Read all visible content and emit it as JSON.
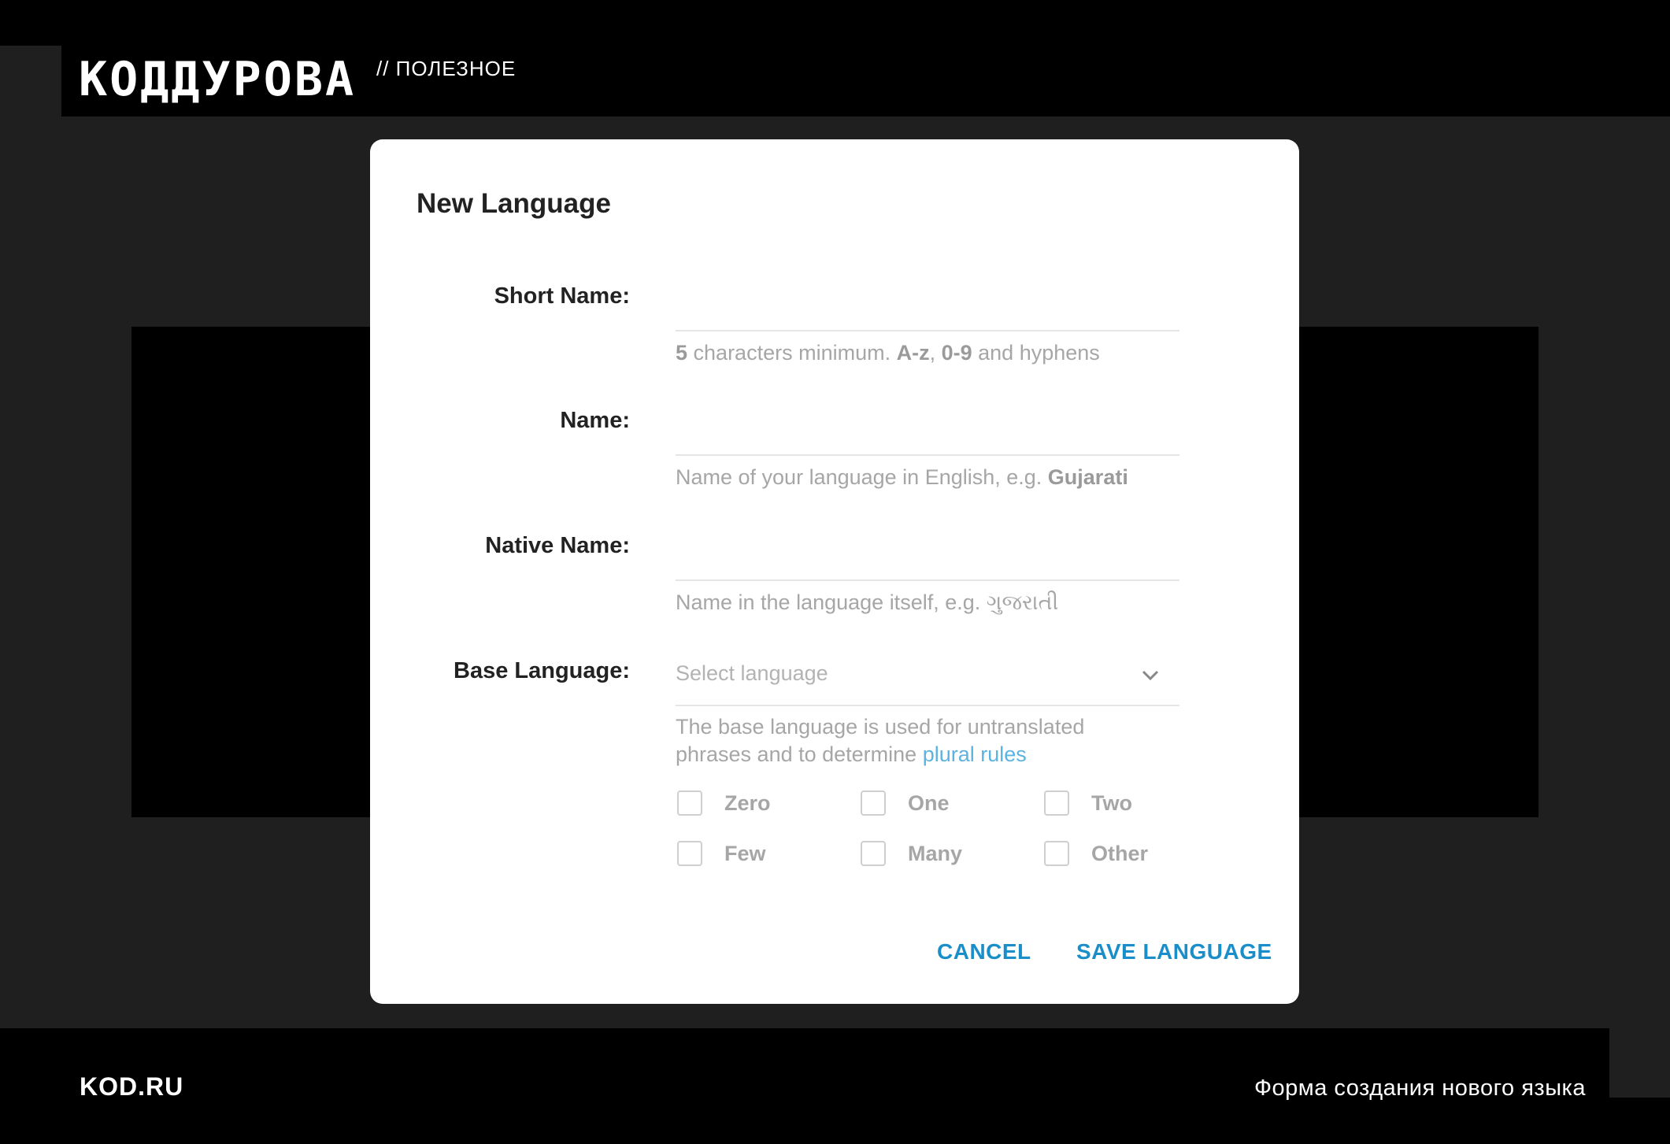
{
  "brand": {
    "logo": "КОДДУРОВА",
    "section": "// ПОЛЕЗНОЕ"
  },
  "footer": {
    "site": "KOD.RU",
    "caption": "Форма создания нового языка"
  },
  "dialog": {
    "title": "New Language",
    "short_name": {
      "label": "Short Name:",
      "value": "",
      "hint_parts": [
        "5",
        " characters minimum. ",
        "A-z",
        ", ",
        "0-9",
        " and hyphens"
      ]
    },
    "name": {
      "label": "Name:",
      "value": "",
      "hint": "Name of your language in English, e.g. ",
      "hint_example": "Gujarati"
    },
    "native_name": {
      "label": "Native Name:",
      "value": "",
      "hint": "Name in the language itself, e.g. ",
      "hint_example": "ગુજરાતી"
    },
    "base_language": {
      "label": "Base Language:",
      "placeholder": "Select language",
      "hint_line1": "The base language is used for untranslated",
      "hint_line2": "phrases and to determine ",
      "hint_link": "plural rules"
    },
    "plural_forms": [
      {
        "label": "Zero",
        "checked": false
      },
      {
        "label": "One",
        "checked": false
      },
      {
        "label": "Two",
        "checked": false
      },
      {
        "label": "Few",
        "checked": false
      },
      {
        "label": "Many",
        "checked": false
      },
      {
        "label": "Other",
        "checked": false
      }
    ],
    "actions": {
      "cancel": "CANCEL",
      "save": "SAVE LANGUAGE"
    }
  },
  "colors": {
    "accent": "#1a8ec9",
    "link": "#5cb3e0",
    "backdrop_panel": "#1f1f1f"
  }
}
